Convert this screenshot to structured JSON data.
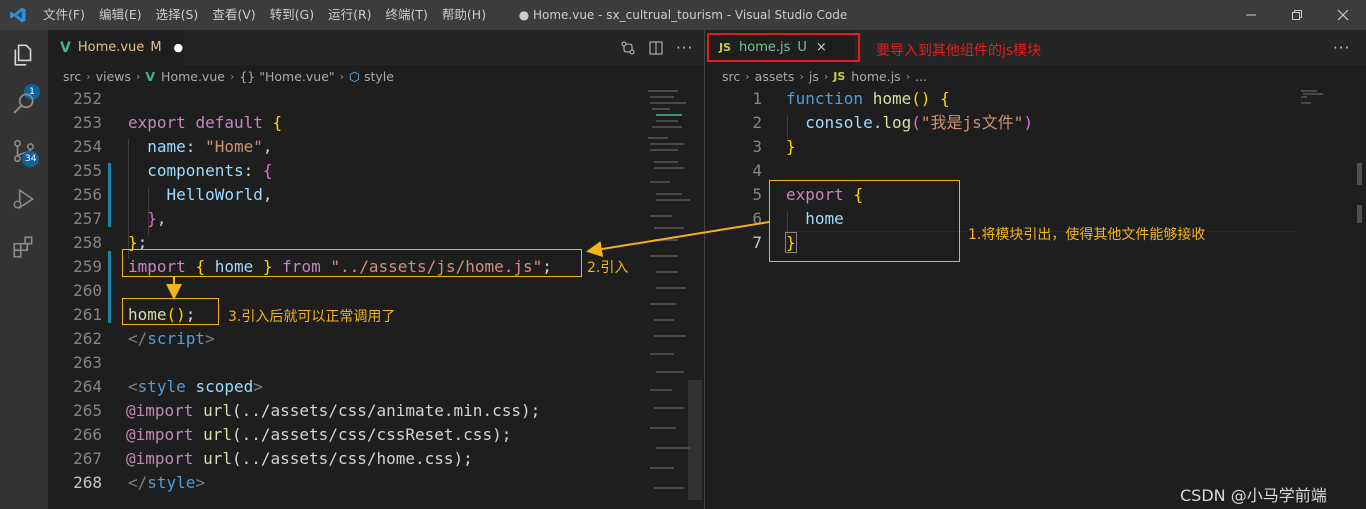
{
  "menu": [
    "文件(F)",
    "编辑(E)",
    "选择(S)",
    "查看(V)",
    "转到(G)",
    "运行(R)",
    "终端(T)",
    "帮助(H)"
  ],
  "window_title": "● Home.vue - sx_cultrual_tourism - Visual Studio Code",
  "activity_badges": {
    "explorer": "1",
    "source_control": "34"
  },
  "left_editor": {
    "tab": {
      "icon": "V",
      "label": "Home.vue",
      "status": "M",
      "dirty": "●"
    },
    "breadcrumb": [
      "src",
      "views",
      "Home.vue",
      "{} \"Home.vue\"",
      "style"
    ],
    "line_numbers": [
      "252",
      "253",
      "254",
      "255",
      "256",
      "257",
      "258",
      "259",
      "260",
      "261",
      "262",
      "263",
      "264",
      "265",
      "266",
      "267",
      "268"
    ]
  },
  "right_editor": {
    "tab": {
      "icon": "JS",
      "label": "home.js",
      "status": "U"
    },
    "breadcrumb": [
      "src",
      "assets",
      "js",
      "home.js",
      "..."
    ],
    "line_numbers": [
      "1",
      "2",
      "3",
      "4",
      "5",
      "6",
      "7"
    ]
  },
  "annotations": {
    "tab_note": "要导入到其他组件的js模块",
    "step1": "1.将模块引出，使得其他文件能够接收",
    "step2": "2.引入",
    "step3": "3.引入后就可以正常调用了"
  },
  "watermark": "CSDN @小马学前端",
  "colors": {
    "annotation": "#f2b416",
    "highlight_red": "#e51c1c",
    "badge": "#0e639c"
  }
}
